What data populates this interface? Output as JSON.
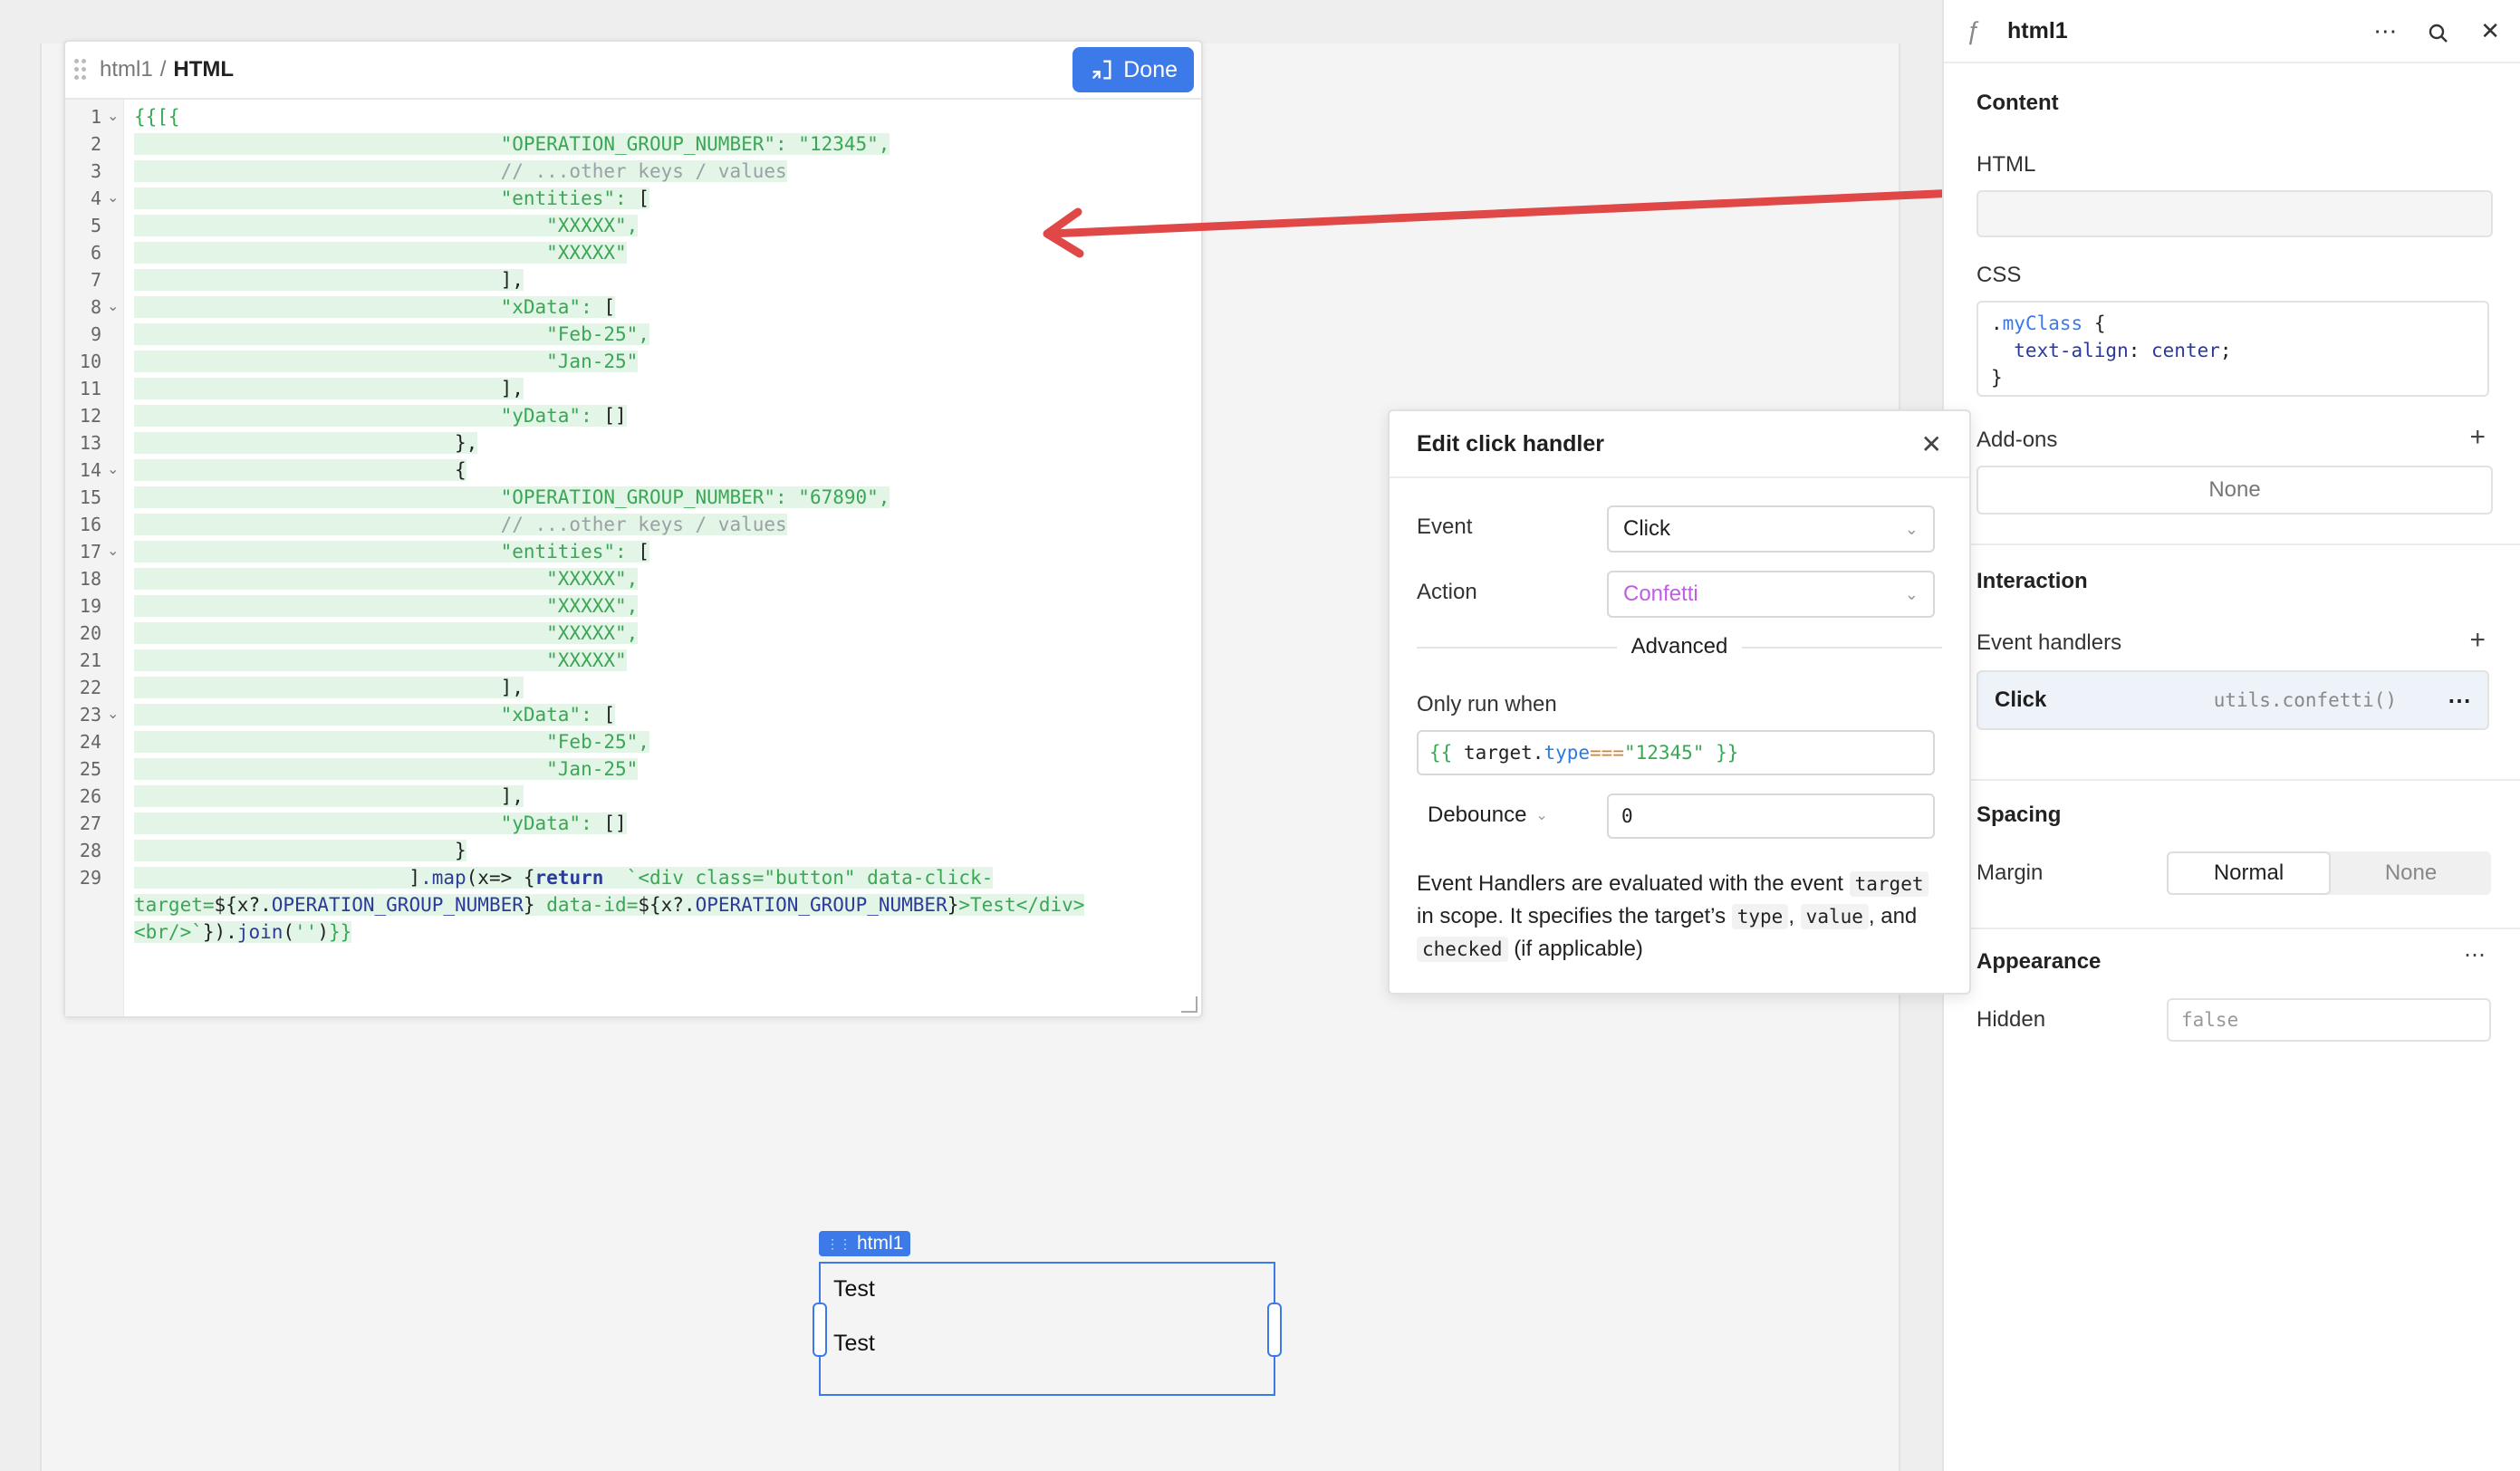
{
  "editor": {
    "crumb_parent": "html1",
    "crumb_sep": "/",
    "crumb_current": "HTML",
    "done_label": "Done",
    "lines": [
      {
        "n": "1",
        "fold": true,
        "indent": 0,
        "hl": false,
        "parts": [
          [
            "g",
            "{{[{"
          ]
        ]
      },
      {
        "n": "2",
        "fold": false,
        "indent": 0,
        "hl": true,
        "parts": [
          [
            "g",
            "                                \"OPERATION_GROUP_NUMBER\": \"12345\","
          ]
        ]
      },
      {
        "n": "3",
        "fold": false,
        "indent": 0,
        "hl": true,
        "parts": [
          [
            "c",
            "                                // ...other keys / values"
          ]
        ]
      },
      {
        "n": "4",
        "fold": true,
        "indent": 0,
        "hl": true,
        "parts": [
          [
            "g",
            "                                \"entities\": "
          ],
          [
            "p",
            "["
          ]
        ]
      },
      {
        "n": "5",
        "fold": false,
        "indent": 0,
        "hl": true,
        "parts": [
          [
            "g",
            "                                    \"XXXXX\","
          ]
        ]
      },
      {
        "n": "6",
        "fold": false,
        "indent": 0,
        "hl": true,
        "parts": [
          [
            "g",
            "                                    \"XXXXX\""
          ]
        ]
      },
      {
        "n": "7",
        "fold": false,
        "indent": 0,
        "hl": true,
        "parts": [
          [
            "p",
            "                                ],"
          ]
        ]
      },
      {
        "n": "8",
        "fold": true,
        "indent": 0,
        "hl": true,
        "parts": [
          [
            "g",
            "                                \"xData\": "
          ],
          [
            "p",
            "["
          ]
        ]
      },
      {
        "n": "9",
        "fold": false,
        "indent": 0,
        "hl": true,
        "parts": [
          [
            "g",
            "                                    \"Feb-25\","
          ]
        ]
      },
      {
        "n": "10",
        "fold": false,
        "indent": 0,
        "hl": true,
        "parts": [
          [
            "g",
            "                                    \"Jan-25\""
          ]
        ]
      },
      {
        "n": "11",
        "fold": false,
        "indent": 0,
        "hl": true,
        "parts": [
          [
            "p",
            "                                ],"
          ]
        ]
      },
      {
        "n": "12",
        "fold": false,
        "indent": 0,
        "hl": true,
        "parts": [
          [
            "g",
            "                                \"yData\": "
          ],
          [
            "p",
            "[]"
          ]
        ]
      },
      {
        "n": "13",
        "fold": false,
        "indent": 0,
        "hl": true,
        "parts": [
          [
            "p",
            "                            },"
          ]
        ]
      },
      {
        "n": "14",
        "fold": true,
        "indent": 0,
        "hl": true,
        "parts": [
          [
            "p",
            "                            {"
          ]
        ]
      },
      {
        "n": "15",
        "fold": false,
        "indent": 0,
        "hl": true,
        "parts": [
          [
            "g",
            "                                \"OPERATION_GROUP_NUMBER\": \"67890\","
          ]
        ]
      },
      {
        "n": "16",
        "fold": false,
        "indent": 0,
        "hl": true,
        "parts": [
          [
            "c",
            "                                // ...other keys / values"
          ]
        ]
      },
      {
        "n": "17",
        "fold": true,
        "indent": 0,
        "hl": true,
        "parts": [
          [
            "g",
            "                                \"entities\": "
          ],
          [
            "p",
            "["
          ]
        ]
      },
      {
        "n": "18",
        "fold": false,
        "indent": 0,
        "hl": true,
        "parts": [
          [
            "g",
            "                                    \"XXXXX\","
          ]
        ]
      },
      {
        "n": "19",
        "fold": false,
        "indent": 0,
        "hl": true,
        "parts": [
          [
            "g",
            "                                    \"XXXXX\","
          ]
        ]
      },
      {
        "n": "20",
        "fold": false,
        "indent": 0,
        "hl": true,
        "parts": [
          [
            "g",
            "                                    \"XXXXX\","
          ]
        ]
      },
      {
        "n": "21",
        "fold": false,
        "indent": 0,
        "hl": true,
        "parts": [
          [
            "g",
            "                                    \"XXXXX\""
          ]
        ]
      },
      {
        "n": "22",
        "fold": false,
        "indent": 0,
        "hl": true,
        "parts": [
          [
            "p",
            "                                ],"
          ]
        ]
      },
      {
        "n": "23",
        "fold": true,
        "indent": 0,
        "hl": true,
        "parts": [
          [
            "g",
            "                                \"xData\": "
          ],
          [
            "p",
            "["
          ]
        ]
      },
      {
        "n": "24",
        "fold": false,
        "indent": 0,
        "hl": true,
        "parts": [
          [
            "g",
            "                                    \"Feb-25\","
          ]
        ]
      },
      {
        "n": "25",
        "fold": false,
        "indent": 0,
        "hl": true,
        "parts": [
          [
            "g",
            "                                    \"Jan-25\""
          ]
        ]
      },
      {
        "n": "26",
        "fold": false,
        "indent": 0,
        "hl": true,
        "parts": [
          [
            "p",
            "                                ],"
          ]
        ]
      },
      {
        "n": "27",
        "fold": false,
        "indent": 0,
        "hl": true,
        "parts": [
          [
            "g",
            "                                \"yData\": "
          ],
          [
            "p",
            "[]"
          ]
        ]
      },
      {
        "n": "28",
        "fold": false,
        "indent": 0,
        "hl": true,
        "parts": [
          [
            "p",
            "                            }"
          ]
        ]
      },
      {
        "n": "29",
        "fold": false,
        "indent": 0,
        "hl": true,
        "parts": [
          [
            "p",
            "                        ]"
          ],
          [
            "b",
            ".map"
          ],
          [
            "p",
            "(x=> {"
          ],
          [
            "k",
            "return"
          ],
          [
            "p",
            "  "
          ],
          [
            "g",
            "`<div class=\"button\" data-click-"
          ]
        ]
      },
      {
        "n": "",
        "fold": false,
        "indent": 0,
        "hl": true,
        "parts": [
          [
            "g",
            "target="
          ],
          [
            "p",
            "${x?."
          ],
          [
            "b",
            "OPERATION_GROUP_NUMBER"
          ],
          [
            "p",
            "} "
          ],
          [
            "g",
            "data-id="
          ],
          [
            "p",
            "${x?."
          ],
          [
            "b",
            "OPERATION_GROUP_NUMBER"
          ],
          [
            "p",
            "}"
          ],
          [
            "g",
            ">Test</div>"
          ]
        ]
      },
      {
        "n": "",
        "fold": false,
        "indent": 0,
        "hl": true,
        "parts": [
          [
            "g",
            "<br/>`"
          ],
          [
            "p",
            "})."
          ],
          [
            "b",
            "join"
          ],
          [
            "p",
            "("
          ],
          [
            "g",
            "''"
          ],
          [
            "p",
            ")"
          ],
          [
            "g",
            "}}"
          ]
        ]
      }
    ]
  },
  "component": {
    "tag": "html1",
    "items": [
      "Test",
      "Test"
    ]
  },
  "panel": {
    "title": "html1",
    "content_title": "Content",
    "html_label": "HTML",
    "css_label": "CSS",
    "css_lines": [
      ".myClass {",
      "  text-align: center;",
      "}"
    ],
    "addons_label": "Add-ons",
    "addons_value": "None",
    "interaction_title": "Interaction",
    "event_handlers_label": "Event handlers",
    "handler_event": "Click",
    "handler_action": "utils.confetti()",
    "spacing_title": "Spacing",
    "margin_label": "Margin",
    "margin_options": [
      "Normal",
      "None"
    ],
    "appearance_title": "Appearance",
    "hidden_label": "Hidden",
    "hidden_placeholder": "false"
  },
  "modal": {
    "title": "Edit click handler",
    "event_label": "Event",
    "event_value": "Click",
    "action_label": "Action",
    "action_value": "Confetti",
    "advanced_label": "Advanced",
    "only_run_label": "Only run when",
    "only_run_open": "{{ ",
    "only_run_target": "target",
    "only_run_dot": ".",
    "only_run_type": "type",
    "only_run_op": "===",
    "only_run_value": "\"12345\"",
    "only_run_close": " }}",
    "debounce_label": "Debounce",
    "debounce_value": "0",
    "help_1": "Event Handlers are evaluated with the event",
    "help_target": "target",
    "help_2": "in scope. It specifies the target’s",
    "help_type": "type",
    "help_3": ",",
    "help_value": "value",
    "help_4": ", and",
    "help_checked": "checked",
    "help_5": "(if applicable)"
  },
  "colors": {
    "accent": "#3b7ae8",
    "arrow": "#e04848",
    "code_green": "#3aa755",
    "action_purple": "#c05ee0"
  }
}
